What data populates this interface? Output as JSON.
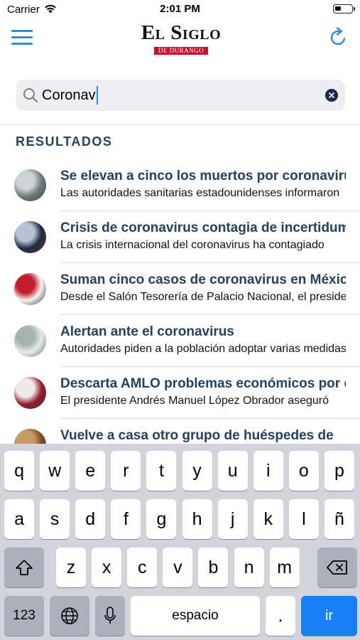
{
  "status": {
    "carrier": "Carrier",
    "time": "2:01 PM",
    "battery_level": 0.35
  },
  "header": {
    "logo_main": "El Siglo",
    "logo_sub": "DE DURANGO"
  },
  "search": {
    "value": "Coronav"
  },
  "results_title": "RESULTADOS",
  "results": [
    {
      "title": "Se elevan a cinco los muertos por coronavirus en EU",
      "summary": "Las autoridades sanitarias estadounidenses informaron",
      "thumb_colors": [
        "#6f7a78",
        "#cdd4d8",
        "#3d4a4d"
      ]
    },
    {
      "title": "Crisis de coronavirus contagia de incertidumbre",
      "summary": "La crisis internacional del coronavirus ha contagiado",
      "thumb_colors": [
        "#1e2a44",
        "#b7c2d4",
        "#7c3030"
      ]
    },
    {
      "title": "Suman cinco casos de coronavirus en México",
      "summary": "Desde el Salón Tesorería de Palacio Nacional, el presidente",
      "thumb_colors": [
        "#f4f4f4",
        "#c41e2a",
        "#2b2b2b"
      ]
    },
    {
      "title": "Alertan ante el coronavirus",
      "summary": "Autoridades piden a la población adoptar varias medidas",
      "thumb_colors": [
        "#e6ece8",
        "#a5b3ad",
        "#5f6f69"
      ]
    },
    {
      "title": "Descarta AMLO problemas económicos por coronavirus",
      "summary": "El presidente Andrés Manuel López Obrador aseguró",
      "thumb_colors": [
        "#9b1d2c",
        "#f0eaea",
        "#2a2e54"
      ]
    },
    {
      "title": "Vuelve a casa otro grupo de huéspedes de",
      "summary": "",
      "thumb_colors": [
        "#7a4e2a",
        "#c89a64",
        "#3d2a18"
      ]
    }
  ],
  "keyboard": {
    "row1": [
      "q",
      "w",
      "e",
      "r",
      "t",
      "y",
      "u",
      "i",
      "o",
      "p"
    ],
    "row2": [
      "a",
      "s",
      "d",
      "f",
      "g",
      "h",
      "j",
      "k",
      "l",
      "ñ"
    ],
    "row3": [
      "z",
      "x",
      "c",
      "v",
      "b",
      "n",
      "m"
    ],
    "numbers_label": "123",
    "space_label": "espacio",
    "period_label": ".",
    "go_label": "ir",
    "icons": {
      "shift": "shift-icon",
      "delete": "delete-icon",
      "globe": "globe-icon",
      "mic": "microphone-icon"
    }
  },
  "colors": {
    "accent": "#2f8ae0",
    "title": "#24415e",
    "logo_red": "#c8102e",
    "go_key": "#1a7ff4"
  }
}
